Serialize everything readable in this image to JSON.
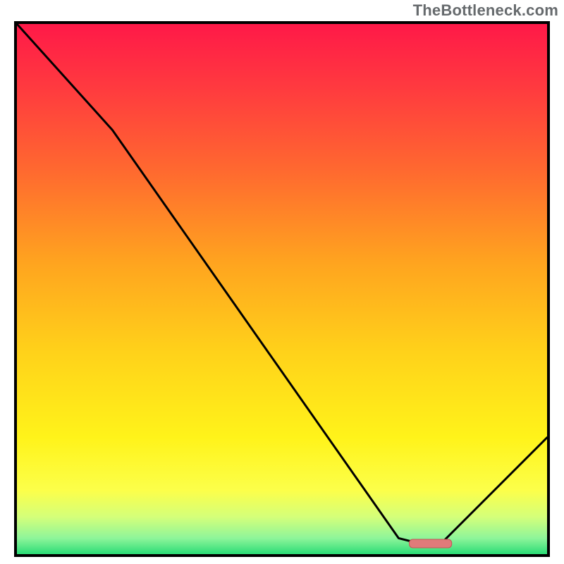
{
  "watermark": "TheBottleneck.com",
  "colors": {
    "border": "#000000",
    "curve": "#000000",
    "marker_fill": "#e07a7a",
    "marker_stroke": "#c25757",
    "gradient_stops": [
      {
        "offset": 0.0,
        "color": "#ff1948"
      },
      {
        "offset": 0.12,
        "color": "#ff3a3f"
      },
      {
        "offset": 0.28,
        "color": "#ff6a2f"
      },
      {
        "offset": 0.45,
        "color": "#ffa41f"
      },
      {
        "offset": 0.62,
        "color": "#ffd21a"
      },
      {
        "offset": 0.78,
        "color": "#fff31a"
      },
      {
        "offset": 0.88,
        "color": "#fcff4a"
      },
      {
        "offset": 0.93,
        "color": "#d4ff7a"
      },
      {
        "offset": 0.97,
        "color": "#8ef59a"
      },
      {
        "offset": 1.0,
        "color": "#2bdc76"
      }
    ]
  },
  "chart_data": {
    "type": "line",
    "title": "",
    "xlabel": "",
    "ylabel": "",
    "xlim": [
      0,
      100
    ],
    "ylim": [
      0,
      100
    ],
    "legend": false,
    "grid": false,
    "series": [
      {
        "name": "bottleneck-curve",
        "x": [
          0,
          18,
          72,
          76,
          80,
          100
        ],
        "values": [
          100,
          80,
          3,
          2,
          2,
          22
        ]
      }
    ],
    "marker": {
      "x_start": 74,
      "x_end": 82,
      "y": 2
    },
    "notes": "Values approximate. Y is bottleneck % (100 top, 0 bottom). Background is a red→green vertical gradient inside a black-bordered square."
  }
}
